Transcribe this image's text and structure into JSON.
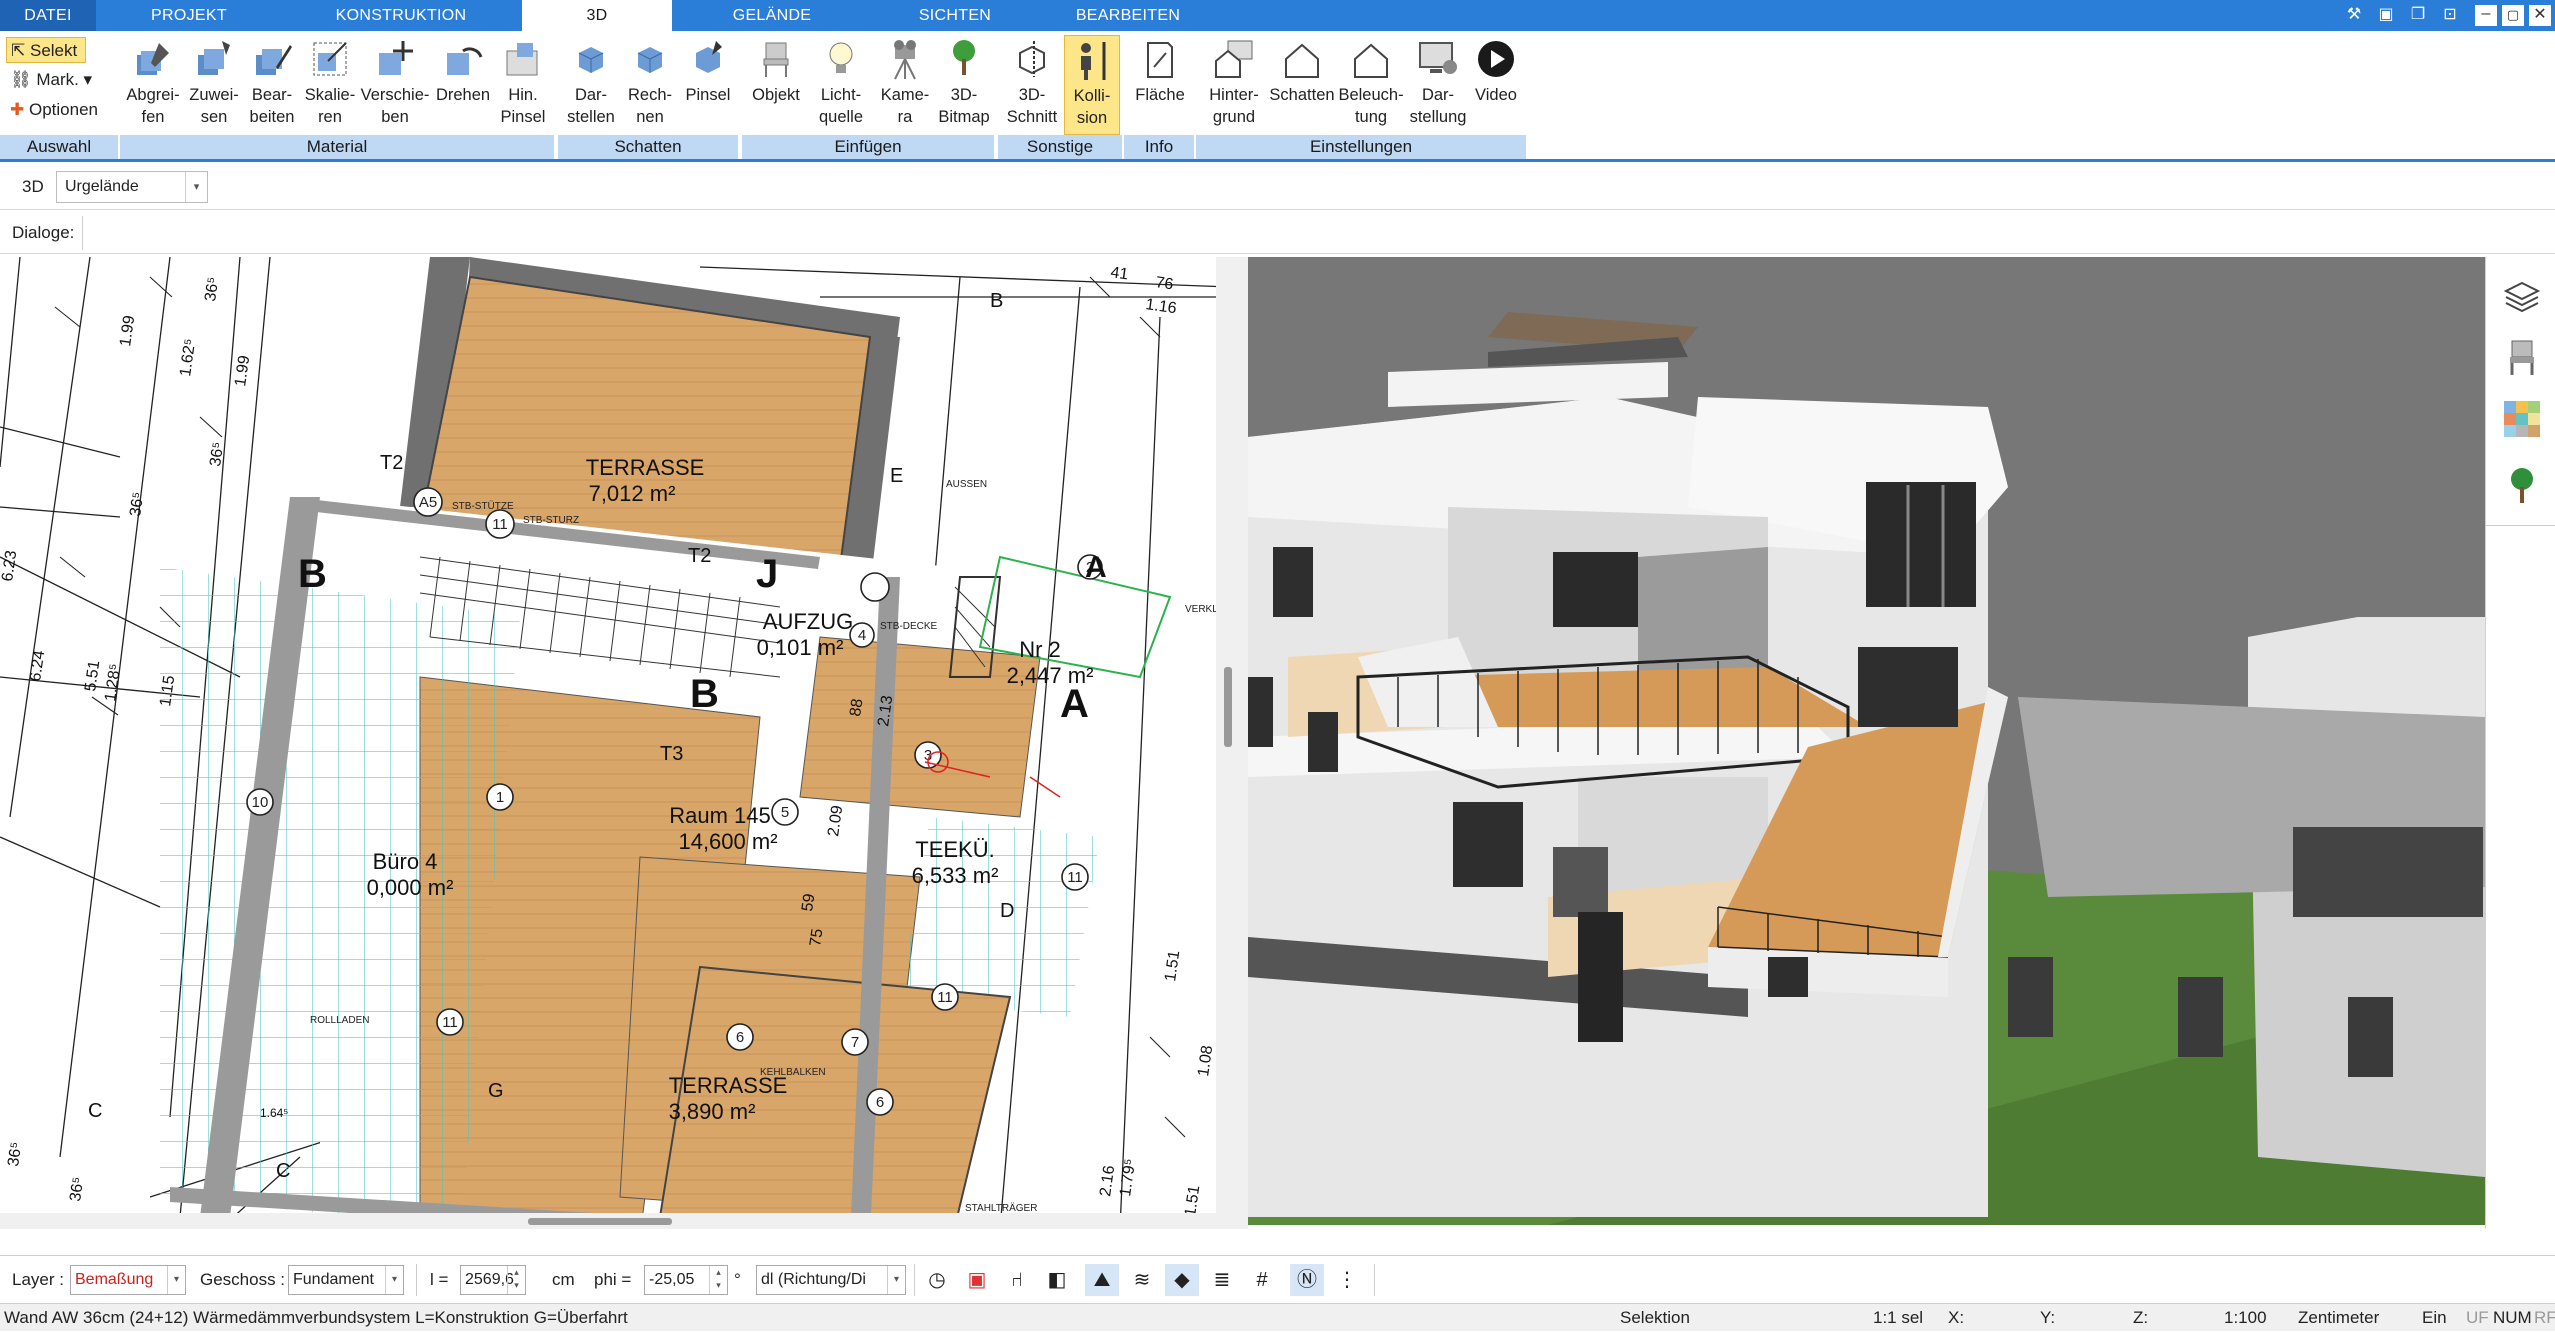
{
  "tabs": {
    "datei": "DATEI",
    "projekt": "PROJEKT",
    "konstruktion": "KONSTRUKTION",
    "d3": "3D",
    "gelaende": "GELÄNDE",
    "sichten": "SICHTEN",
    "bearbeiten": "BEARBEITEN"
  },
  "ribbon": {
    "auswahl": {
      "selekt": "Selekt",
      "mark": "Mark.",
      "optionen": "Optionen",
      "group": "Auswahl"
    },
    "material": {
      "group": "Material",
      "abgreifen": "Abgrei-\nfen",
      "zuweisen": "Zuwei-\nsen",
      "bearbeiten": "Bear-\nbeiten",
      "skalieren": "Skalie-\nren",
      "verschieben": "Verschie-\nben",
      "drehen": "Drehen",
      "hinpinsel": "Hin.\nPinsel"
    },
    "schatten": {
      "group": "Schatten",
      "darstellen": "Dar-\nstellen",
      "rechnen": "Rech-\nnen",
      "pinsel": "Pinsel"
    },
    "einfuegen": {
      "group": "Einfügen",
      "objekt": "Objekt",
      "lichtquelle": "Licht-\nquelle",
      "kamera": "Kame-\nra",
      "bitmap": "3D-\nBitmap"
    },
    "sonstige": {
      "group": "Sonstige",
      "schnitt": "3D-\nSchnitt",
      "kollision": "Kolli-\nsion"
    },
    "info": {
      "group": "Info",
      "flaeche": "Fläche"
    },
    "einstellungen": {
      "group": "Einstellungen",
      "hintergrund": "Hinter-\ngrund",
      "schatten": "Schatten",
      "beleuchtung": "Beleuch-\ntung",
      "darstellung": "Dar-\nstellung",
      "video": "Video"
    }
  },
  "bar3d": {
    "label": "3D",
    "select": "Urgelände"
  },
  "dialogbar": {
    "label": "Dialoge:"
  },
  "plan": {
    "rooms": [
      {
        "name": "TERRASSE",
        "area": "7,012 m²"
      },
      {
        "name": "AUFZUG",
        "area": "0,101 m²"
      },
      {
        "name": "Nr 2",
        "area": "2,447 m²"
      },
      {
        "name": "Raum 145",
        "area": "14,600 m²"
      },
      {
        "name": "TEEKÜ.",
        "area": "6,533 m²"
      },
      {
        "name": "Büro 4",
        "area": "0,000 m²"
      },
      {
        "name": "TERRASSE",
        "area": "3,890 m²"
      }
    ],
    "dims": [
      "1.99",
      "1.62⁵",
      "1.99",
      "36⁵",
      "36⁵",
      "36⁵",
      "6.23",
      "6.24",
      "5.51",
      "1.28⁵",
      "1.15",
      "41",
      "76",
      "1.16",
      "1.51",
      "1.51",
      "2.16",
      "1.79⁵",
      "1.08",
      "36⁵",
      "36⁵",
      "1.64⁵",
      "2.13",
      "88",
      "59",
      "75",
      "2.09"
    ],
    "section_marks": [
      "B",
      "B",
      "J",
      "A",
      "A",
      "T2",
      "T2",
      "T3",
      "C",
      "C",
      "E",
      "D",
      "B",
      "G",
      "E"
    ],
    "labels": [
      "STB-STÜTZE",
      "STB-STURZ",
      "STB-DECKE",
      "AUSSEN",
      "STAHLTRÄGER",
      "KEHLBALKEN",
      "ROLLLADEN",
      "VERKLE"
    ],
    "circle_nums": [
      "A5",
      "11",
      "4",
      "3",
      "1",
      "2",
      "5",
      "10",
      "11",
      "11",
      "11",
      "6",
      "7",
      "6"
    ]
  },
  "bottombar": {
    "layer_label": "Layer :",
    "layer_value": "Bemaßung",
    "geschoss_label": "Geschoss :",
    "geschoss_value": "Fundament",
    "l_label": "l =",
    "l_value": "2569,6",
    "l_unit": "cm",
    "phi_label": "phi =",
    "phi_value": "-25,05",
    "phi_unit": "°",
    "dl_value": "dl (Richtung/Di"
  },
  "status": {
    "description": "Wand AW 36cm (24+12) Wärmedämmverbundsystem L=Konstruktion G=Überfahrt",
    "mode": "Selektion",
    "sel": "1:1 sel",
    "x": "X:",
    "y": "Y:",
    "z": "Z:",
    "scale": "1:100",
    "unit": "Zentimeter",
    "ein": "Ein",
    "uf": "UF",
    "num": "NUM",
    "rf": "RF"
  },
  "colors": {
    "accent": "#2b7ed7",
    "group_bar": "#bfd8f4",
    "wood": "#d9a66a",
    "grid": "#47c6c6",
    "lawn": "#5a8a3c",
    "bg3d": "#777777"
  }
}
